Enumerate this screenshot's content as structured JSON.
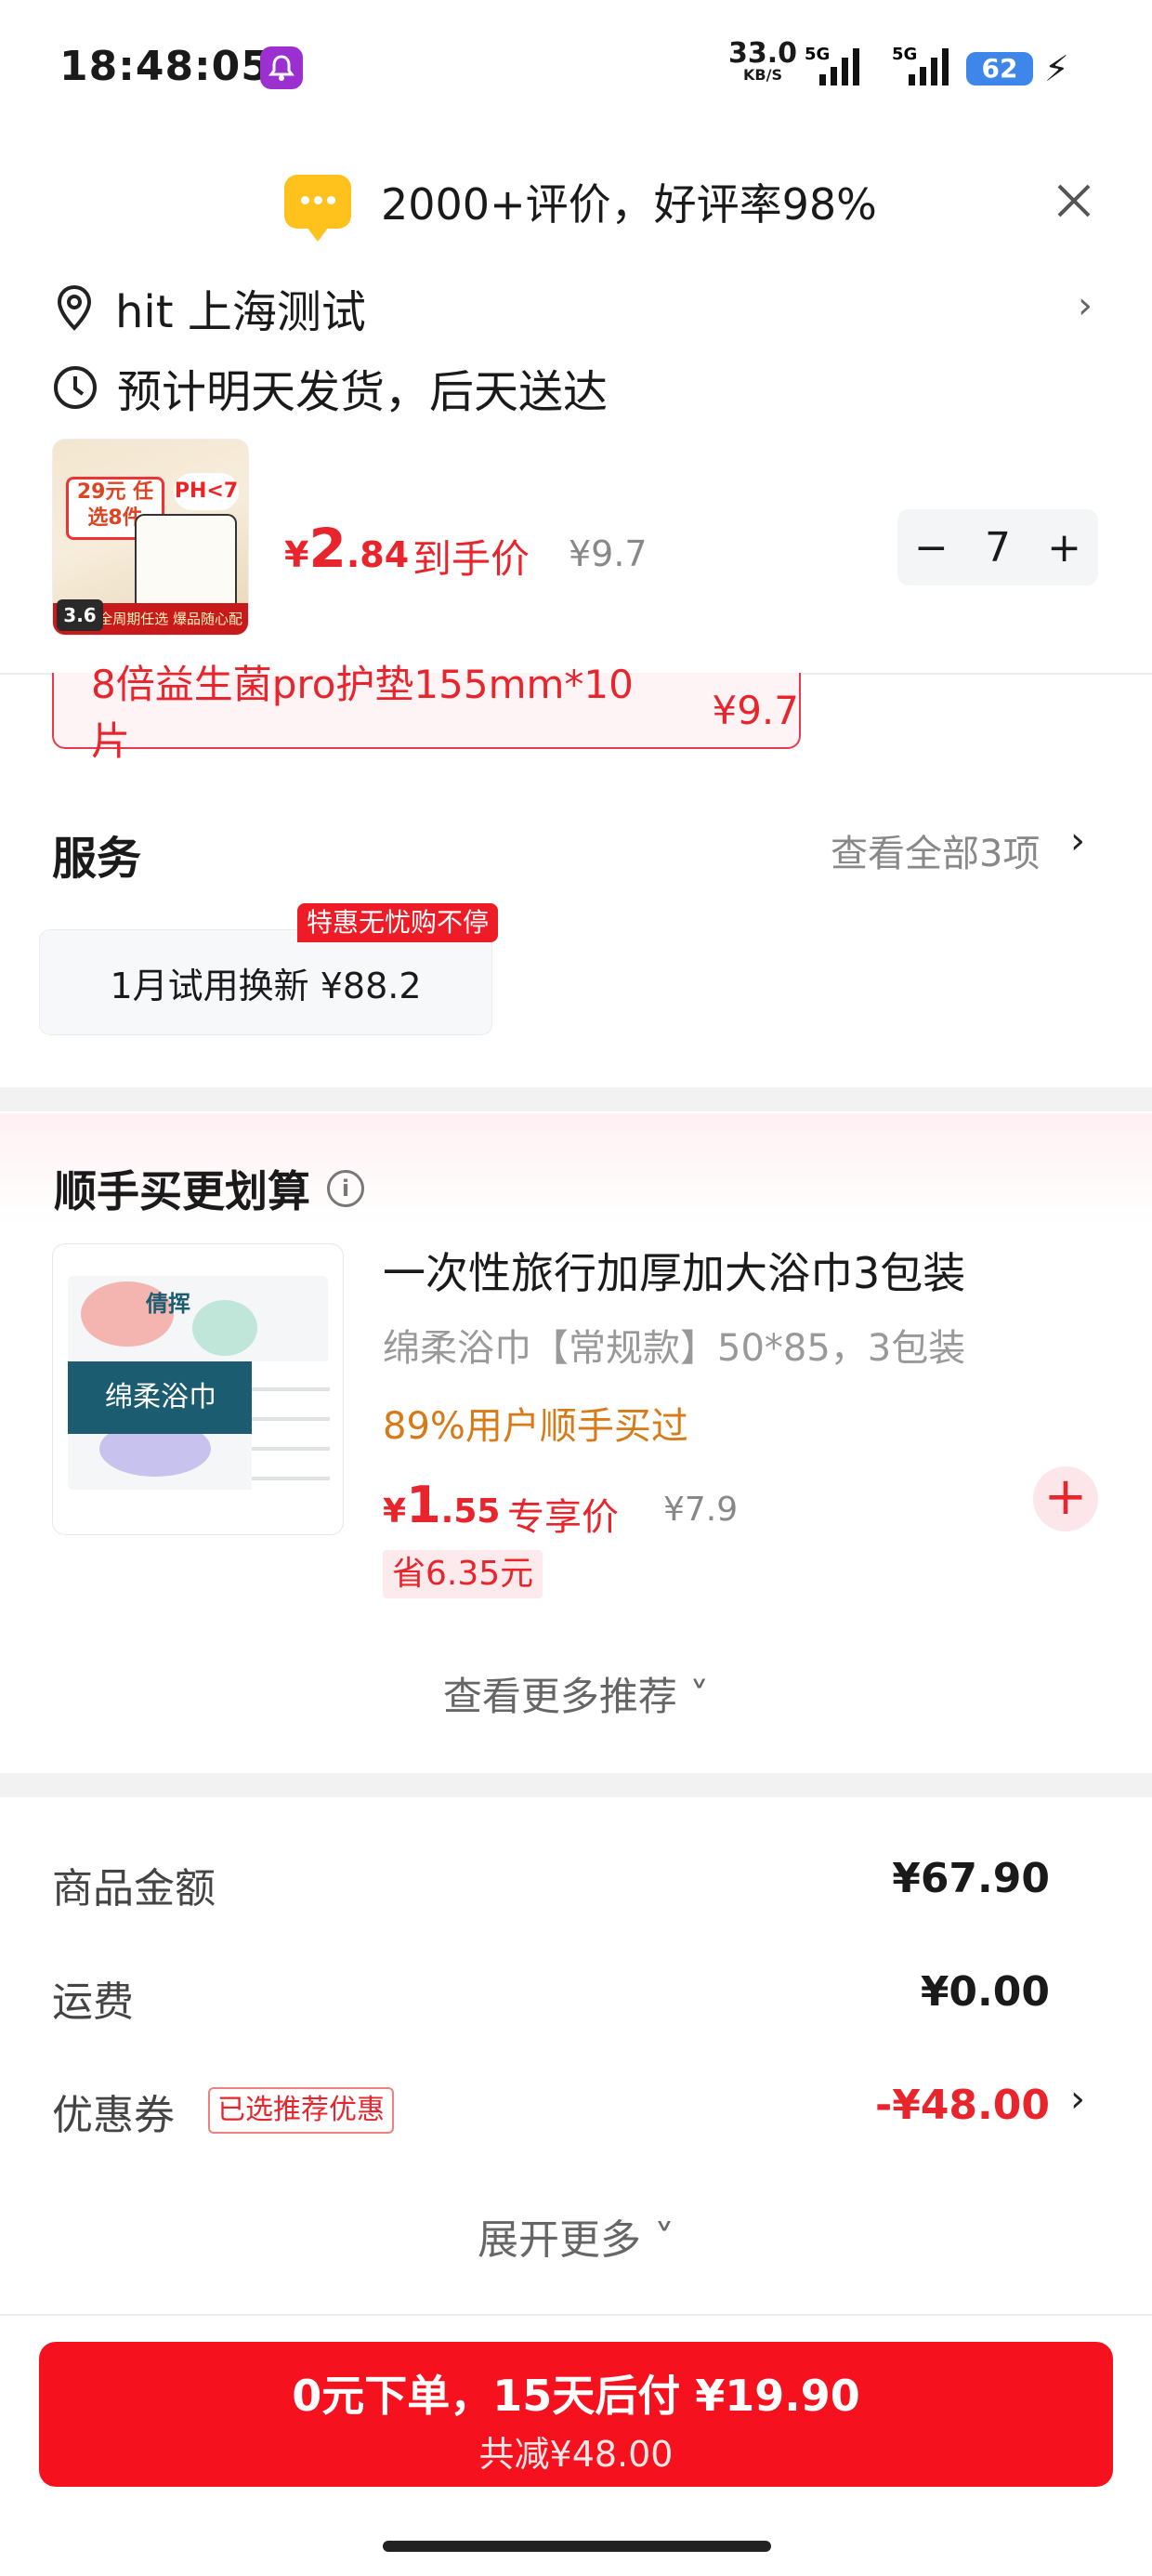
{
  "status_bar": {
    "time": "18:48:05",
    "net_speed": "33.0",
    "net_unit": "KB/S",
    "net_type_1": "5G",
    "net_type_2": "5G",
    "battery": "62"
  },
  "header": {
    "review_summary": "2000+评价，好评率98%",
    "address": "hit  上海测试",
    "shipping": "预计明天发货，后天送达"
  },
  "product": {
    "thumb_promo": "29元 任选8件",
    "thumb_ph": "PH<7",
    "thumb_score": "3.6",
    "thumb_bottom": "全周期任选 爆品随心配",
    "price_currency": "¥",
    "price_int": "2",
    "price_dec": ".84",
    "price_tag": "到手价",
    "original_price": "¥9.7",
    "quantity": "7"
  },
  "sku_chip": {
    "name": "8倍益生菌pro护垫155mm*10片",
    "price": "¥9.7"
  },
  "services": {
    "title": "服务",
    "view_all": "查看全部3项",
    "badge": "特惠无忧购不停",
    "item": "1月试用换新  ¥88.2"
  },
  "recommend": {
    "title": "顺手买更划算",
    "img_logo": "倩挥",
    "img_band": "绵柔浴巾",
    "name": "一次性旅行加厚加大浴巾3包装",
    "spec": "绵柔浴巾【常规款】50*85，3包装",
    "buyers": "89%用户顺手买过",
    "price_currency": "¥",
    "price_int": "1",
    "price_dec": ".55",
    "price_tag": "专享价",
    "original_price": "¥7.9",
    "save": "省6.35元",
    "more": "查看更多推荐"
  },
  "summary": {
    "goods_label": "商品金额",
    "goods_value": "¥67.90",
    "shipping_label": "运费",
    "shipping_value": "¥0.00",
    "coupon_label": "优惠券",
    "coupon_pill": "已选推荐优惠",
    "coupon_value": "-¥48.00",
    "expand": "展开更多"
  },
  "cta": {
    "main": "0元下单，15天后付 ¥19.90",
    "sub": "共减¥48.00"
  },
  "colors": {
    "accent_red": "#f5121e",
    "price_red": "#e8242c",
    "buyers_orange": "#d77a18",
    "chat_yellow": "#ffc21c"
  }
}
